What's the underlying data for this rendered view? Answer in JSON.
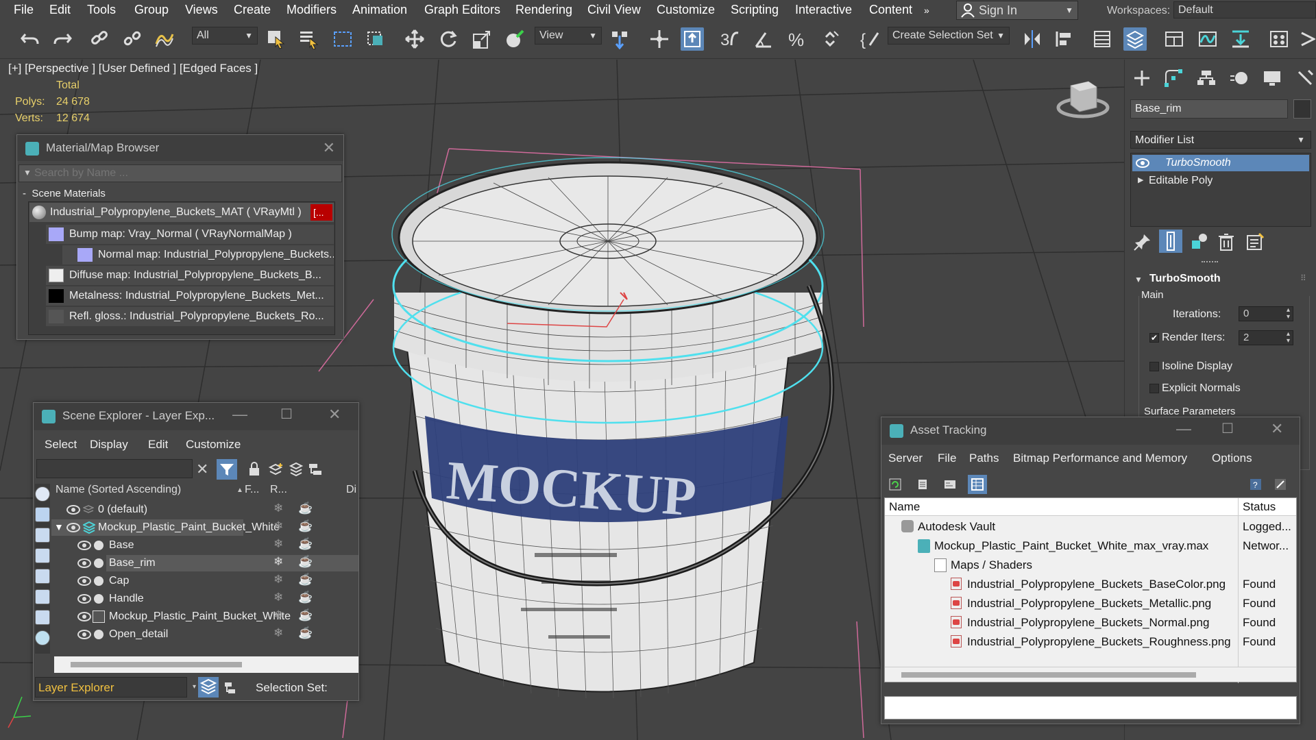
{
  "menu": {
    "items": [
      "File",
      "Edit",
      "Tools",
      "Group",
      "Views",
      "Create",
      "Modifiers",
      "Animation",
      "Graph Editors",
      "Rendering",
      "Civil View",
      "Customize",
      "Scripting",
      "Interactive",
      "Content"
    ],
    "overflow": "»",
    "sign_in": "Sign In",
    "workspaces_label": "Workspaces:",
    "workspace_value": "Default"
  },
  "toolbar": {
    "filter_value": "All",
    "refcoord_value": "View",
    "selection_set_placeholder": "Create Selection Set"
  },
  "viewport": {
    "label": "[+] [Perspective ] [User Defined ] [Edged Faces ]",
    "stats_total": "Total",
    "polys_label": "Polys:",
    "polys_value": "24 678",
    "verts_label": "Verts:",
    "verts_value": "12 674",
    "mockup_text": "MOCKUP"
  },
  "material_browser": {
    "title": "Material/Map Browser",
    "search_placeholder": "Search by Name ...",
    "section": "Scene Materials",
    "rows": [
      "Industrial_Polypropylene_Buckets_MAT  ( VRayMtl )",
      "Bump map: Vray_Normal  ( VRayNormalMap )",
      "Normal  map:  Industrial_Polypropylene_Buckets...",
      "Diffuse  map:  Industrial_Polypropylene_Buckets_B...",
      "Metalness:  Industrial_Polypropylene_Buckets_Met...",
      "Refl.  gloss.:  Industrial_Polypropylene_Buckets_Ro..."
    ],
    "red_tag": "[..."
  },
  "scene_explorer": {
    "title": "Scene Explorer - Layer Exp...",
    "menu": [
      "Select",
      "Display",
      "Edit",
      "Customize"
    ],
    "col_name": "Name (Sorted Ascending)",
    "col_f": "F...",
    "col_r": "R...",
    "col_d": "Di",
    "rows": [
      "0 (default)",
      "Mockup_Plastic_Paint_Bucket_White",
      "Base",
      "Base_rim",
      "Cap",
      "Handle",
      "Mockup_Plastic_Paint_Bucket_White",
      "Open_detail"
    ],
    "footer_value": "Layer Explorer",
    "selection_set_label": "Selection Set:"
  },
  "asset_tracking": {
    "title": "Asset Tracking",
    "menu": [
      "Server",
      "File",
      "Paths",
      "Bitmap Performance and Memory",
      "Options"
    ],
    "col_name": "Name",
    "col_status": "Status",
    "rows": [
      {
        "name": "Autodesk Vault",
        "status": "Logged..."
      },
      {
        "name": "Mockup_Plastic_Paint_Bucket_White_max_vray.max",
        "status": "Networ..."
      },
      {
        "name": "Maps / Shaders",
        "status": ""
      },
      {
        "name": "Industrial_Polypropylene_Buckets_BaseColor.png",
        "status": "Found"
      },
      {
        "name": "Industrial_Polypropylene_Buckets_Metallic.png",
        "status": "Found"
      },
      {
        "name": "Industrial_Polypropylene_Buckets_Normal.png",
        "status": "Found"
      },
      {
        "name": "Industrial_Polypropylene_Buckets_Roughness.png",
        "status": "Found"
      }
    ]
  },
  "command_panel": {
    "object_name": "Base_rim",
    "modifier_list": "Modifier List",
    "stack": [
      "TurboSmooth",
      "Editable Poly"
    ],
    "rollout": "TurboSmooth",
    "main": "Main",
    "iterations_label": "Iterations:",
    "iterations_value": "0",
    "render_iters_label": "Render Iters:",
    "render_iters_value": "2",
    "isoline": "Isoline Display",
    "explicit": "Explicit Normals",
    "surface": "Surface Parameters"
  },
  "colors": {
    "accent": "#5c87b8",
    "selection_cyan": "#4fe0ee",
    "stat_yellow": "#e8d06a",
    "label_blue": "#2d3f7a"
  }
}
